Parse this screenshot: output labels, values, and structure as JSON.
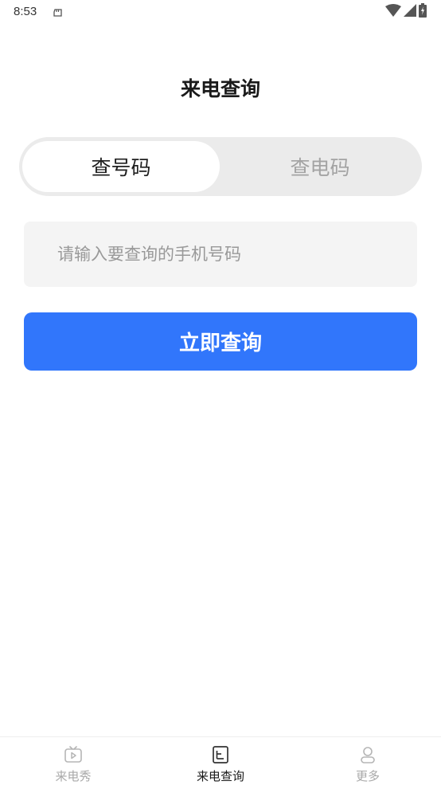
{
  "status_bar": {
    "time": "8:53"
  },
  "page": {
    "title": "来电查询"
  },
  "tabs": [
    {
      "label": "查号码",
      "active": true
    },
    {
      "label": "查电码",
      "active": false
    }
  ],
  "search": {
    "placeholder": "请输入要查询的手机号码",
    "value": ""
  },
  "submit_label": "立即查询",
  "bottom_nav": [
    {
      "label": "来电秀",
      "icon": "tv-play-icon",
      "active": false
    },
    {
      "label": "来电查询",
      "icon": "document-list-icon",
      "active": true
    },
    {
      "label": "更多",
      "icon": "user-icon",
      "active": false
    }
  ],
  "colors": {
    "accent": "#3176fb",
    "segment_background": "#ebebeb",
    "input_background": "#f4f4f4",
    "inactive_text": "#a3a3a3"
  }
}
